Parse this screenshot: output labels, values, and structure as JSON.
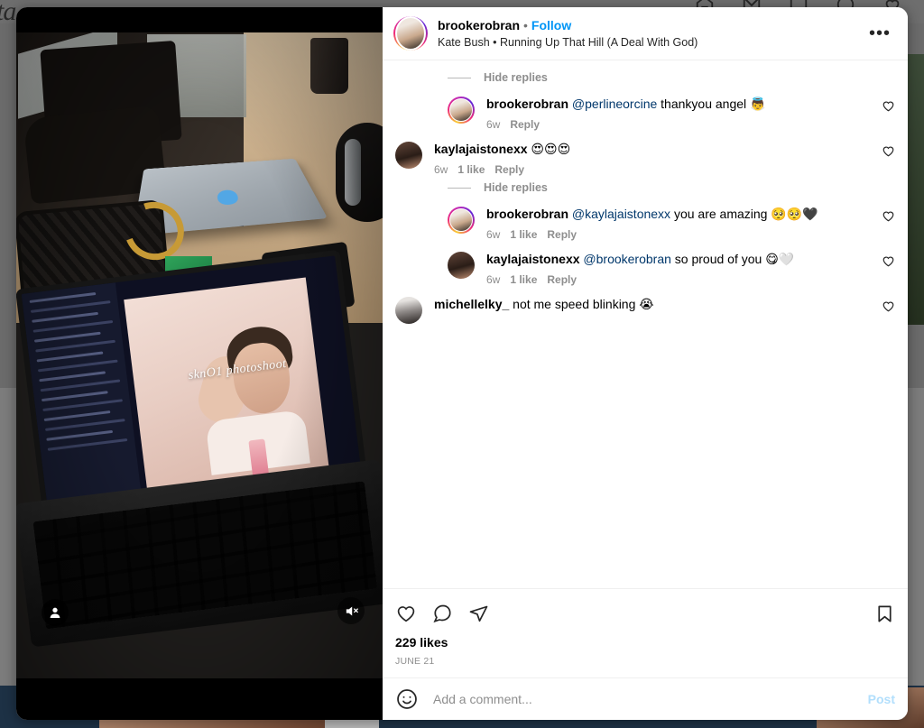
{
  "background": {
    "brand_text": "ta",
    "nav_icons": [
      "home-icon",
      "messenger-icon",
      "new-post-icon",
      "explore-icon",
      "activity-heart-icon"
    ]
  },
  "post": {
    "header": {
      "username": "brookerobran",
      "separator": "•",
      "follow_label": "Follow",
      "audio": "Kate Bush • Running Up That Hill (A Deal With God)",
      "more_options": "•••",
      "avatar": "brookerobran-avatar"
    },
    "media": {
      "overlay_text": "sknO1 photoshoot",
      "tagged_users_icon": "person-tag-icon",
      "mute_icon": "audio-muted-icon"
    },
    "comments": [
      {
        "kind": "hide-replies",
        "label": "Hide replies"
      },
      {
        "kind": "reply",
        "avatar": "brookerobran-avatar",
        "ringed": true,
        "username": "brookerobran",
        "mention": "@perlineorcine",
        "text": " thankyou angel ",
        "emoji": "👼",
        "time": "6w",
        "likes": "",
        "reply_label": "Reply"
      },
      {
        "kind": "comment",
        "avatar": "kaylajaistonexx-avatar",
        "ringed": false,
        "username": "kaylajaistonexx",
        "mention": "",
        "text": " ",
        "emoji": "😍😍😍",
        "time": "6w",
        "likes": "1 like",
        "reply_label": "Reply"
      },
      {
        "kind": "hide-replies",
        "label": "Hide replies"
      },
      {
        "kind": "reply",
        "avatar": "brookerobran-avatar",
        "ringed": true,
        "username": "brookerobran",
        "mention": "@kaylajaistonexx",
        "text": " you are amazing ",
        "emoji": "🥺🥺🖤",
        "time": "6w",
        "likes": "1 like",
        "reply_label": "Reply"
      },
      {
        "kind": "reply",
        "avatar": "kaylajaistonexx-avatar",
        "ringed": false,
        "username": "kaylajaistonexx",
        "mention": "@brookerobran",
        "text": " so proud of you ",
        "emoji": "😋🤍",
        "time": "6w",
        "likes": "1 like",
        "reply_label": "Reply"
      },
      {
        "kind": "comment",
        "avatar": "michellelky-avatar",
        "ringed": false,
        "username": "michellelky_",
        "mention": "",
        "text": " not me speed blinking ",
        "emoji": "😭",
        "time": "",
        "likes": "",
        "reply_label": ""
      }
    ],
    "actions": {
      "like_icon": "heart-icon",
      "comment_icon": "comment-icon",
      "share_icon": "share-icon",
      "save_icon": "bookmark-icon"
    },
    "likes_text": "229 likes",
    "date_text": "JUNE 21",
    "add_comment": {
      "emoji_icon": "emoji-smiley-icon",
      "value": "",
      "placeholder": "Add a comment...",
      "post_label": "Post"
    }
  },
  "colors": {
    "link_blue": "#0095f6",
    "mention_blue": "#00376b",
    "muted_grey": "#8e8e8e",
    "post_disabled": "#b2dffc"
  }
}
